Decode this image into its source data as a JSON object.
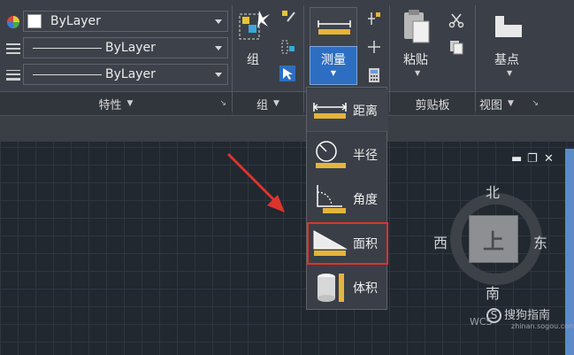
{
  "properties_panel": {
    "title": "特性",
    "color_value": "ByLayer",
    "linetype_value": "ByLayer",
    "lineweight_value": "ByLayer"
  },
  "group_panel": {
    "title": "组",
    "group_button_label": "组"
  },
  "utilities_panel": {
    "measure_button_label": "测量"
  },
  "clipboard_panel": {
    "title": "剪贴板",
    "paste_button_label": "粘贴"
  },
  "view_panel": {
    "title": "视图",
    "base_point_label": "基点"
  },
  "measure_menu": {
    "items": [
      {
        "label": "距离",
        "icon": "distance-icon"
      },
      {
        "label": "半径",
        "icon": "radius-icon"
      },
      {
        "label": "角度",
        "icon": "angle-icon"
      },
      {
        "label": "面积",
        "icon": "area-icon",
        "highlighted": true
      },
      {
        "label": "体积",
        "icon": "volume-icon"
      }
    ]
  },
  "viewcube": {
    "top_face": "上",
    "north": "北",
    "south": "南",
    "east": "东",
    "west": "西"
  },
  "ucs_label": "WCS",
  "watermark": {
    "text": "搜狗指南",
    "url": "zhinan.sogou.com"
  },
  "colors": {
    "ribbon_bg": "#3b4048",
    "accent_blue": "#2d6ec2",
    "highlight_red": "#e0322c",
    "canvas_bg": "#212830"
  }
}
